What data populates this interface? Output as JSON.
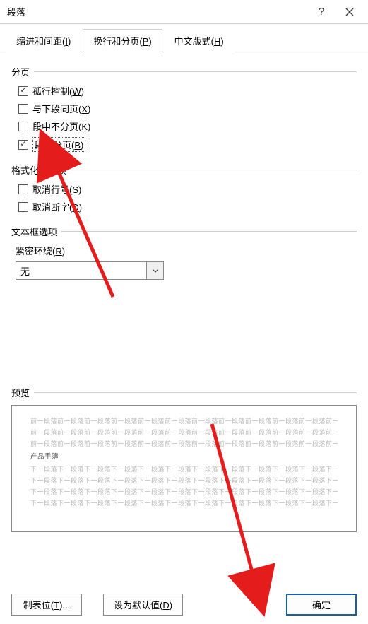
{
  "titlebar": {
    "title": "段落",
    "help": "?",
    "close": "close"
  },
  "tabs": {
    "indent": {
      "label_pre": "缩进和间距(",
      "mnemonic": "I",
      "label_post": ")"
    },
    "page": {
      "label_pre": "换行和分页(",
      "mnemonic": "P",
      "label_post": ")"
    },
    "cjk": {
      "label_pre": "中文版式(",
      "mnemonic": "H",
      "label_post": ")"
    }
  },
  "sections": {
    "pagination": "分页",
    "formatting_exceptions": "格式化例外项",
    "textbox_options": "文本框选项",
    "preview": "预览"
  },
  "checkboxes": {
    "widow": {
      "label_pre": "孤行控制(",
      "mnemonic": "W",
      "label_post": ")",
      "checked": true
    },
    "keep_next": {
      "label_pre": "与下段同页(",
      "mnemonic": "X",
      "label_post": ")",
      "checked": false
    },
    "keep_lines": {
      "label_pre": "段中不分页(",
      "mnemonic": "K",
      "label_post": ")",
      "checked": false
    },
    "page_break": {
      "label_pre": "段前分页(",
      "mnemonic": "B",
      "label_post": ")",
      "checked": true,
      "focused": true
    },
    "suppress_ln": {
      "label_pre": "取消行号(",
      "mnemonic": "S",
      "label_post": ")",
      "checked": false
    },
    "no_hyphen": {
      "label_pre": "取消断字(",
      "mnemonic": "D",
      "label_post": ")",
      "checked": false
    }
  },
  "tight_wrap": {
    "label_pre": "紧密环绕(",
    "mnemonic": "R",
    "label_post": ")"
  },
  "combo": {
    "value": "无"
  },
  "preview": {
    "before": "前一段落前一段落前一段落前一段落前一段落前一段落前一段落前一段落前一段落前一段落前一段落前一段落前一段落前一段落前一段落前一段落前一段落前一段落前一段落前一段落前一段落前一段落前一段落前一段落前一段落前一段落",
    "sample": "产品手簿",
    "after": "下一段落下一段落下一段落下一段落下一段落下一段落下一段落下一段落下一段落下一段落下一段落下一段落下一段落下一段落下一段落下一段落下一段落下一段落下一段落下一段落下一段落下一段落下一段落下一段落下一段落下一段落下一段落下一段落下一段落下一段落"
  },
  "buttons": {
    "tabs": {
      "label_pre": "制表位(",
      "mnemonic": "T",
      "label_post": ")..."
    },
    "default": {
      "label_pre": "设为默认值(",
      "mnemonic": "D",
      "label_post": ")"
    },
    "ok": {
      "label": "确定"
    }
  }
}
